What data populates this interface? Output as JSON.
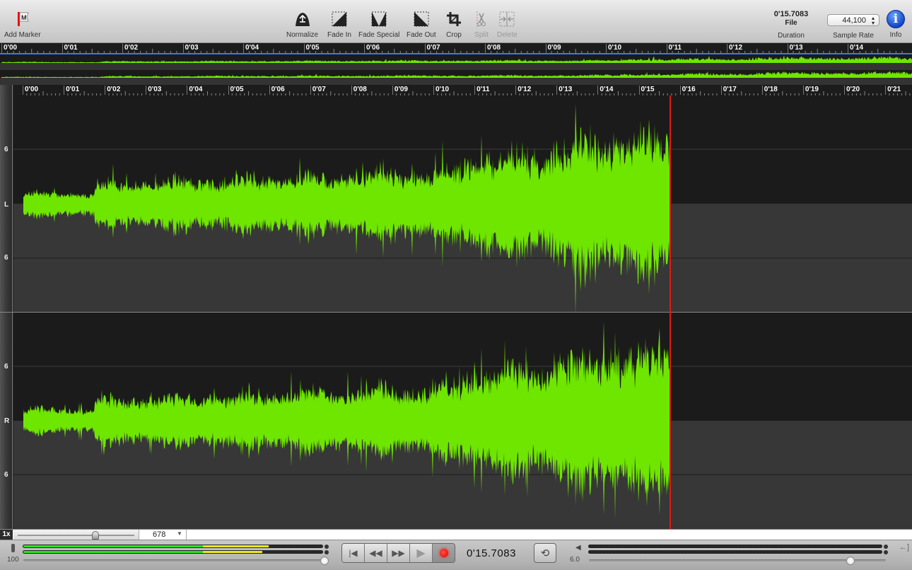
{
  "toolbar": {
    "add_marker": {
      "label": "Add Marker",
      "icon": "marker-flag-icon",
      "glyph": "M"
    },
    "tools": [
      {
        "label": "Normalize",
        "icon": "normalize-icon",
        "enabled": true
      },
      {
        "label": "Fade In",
        "icon": "fade-in-icon",
        "enabled": true
      },
      {
        "label": "Fade Special",
        "icon": "fade-special-icon",
        "enabled": true
      },
      {
        "label": "Fade Out",
        "icon": "fade-out-icon",
        "enabled": true
      },
      {
        "label": "Crop",
        "icon": "crop-icon",
        "enabled": true
      },
      {
        "label": "Split",
        "icon": "scissors-icon",
        "enabled": false
      },
      {
        "label": "Delete",
        "icon": "delete-icon",
        "enabled": false
      }
    ],
    "duration": {
      "time": "0'15.7083",
      "source": "File",
      "label": "Duration"
    },
    "sample_rate": {
      "value": "44,100",
      "label": "Sample Rate"
    },
    "info": {
      "label": "Info",
      "glyph": "i"
    }
  },
  "overview": {
    "ruler_labels": [
      "0'00",
      "0'01",
      "0'02",
      "0'03",
      "0'04",
      "0'05",
      "0'06",
      "0'07",
      "0'08",
      "0'09",
      "0'10",
      "0'11",
      "0'12",
      "0'13",
      "0'14"
    ]
  },
  "editor": {
    "ruler_labels": [
      "0'00",
      "0'01",
      "0'02",
      "0'03",
      "0'04",
      "0'05",
      "0'06",
      "0'07",
      "0'08",
      "0'09",
      "0'10",
      "0'11",
      "0'12",
      "0'13",
      "0'14",
      "0'15",
      "0'16",
      "0'17",
      "0'18",
      "0'19",
      "0'20",
      "0'21"
    ],
    "channels": [
      {
        "name": "L",
        "scale_top": "6",
        "scale_bottom": "6"
      },
      {
        "name": "R",
        "scale_top": "6",
        "scale_bottom": "6"
      }
    ],
    "playhead_time": "0'15.7083"
  },
  "zoom": {
    "factor_label": "1x",
    "value": "678",
    "dropdown_icon": "▼"
  },
  "transport": {
    "input_level_label": "100",
    "input_meter": {
      "left_green": 0.6,
      "left_yellow": 0.82,
      "right_green": 0.6,
      "right_yellow": 0.8
    },
    "input_volume": 1.0,
    "buttons": [
      {
        "name": "skip-to-start",
        "glyph": "⏮",
        "icon": "skip-start-icon"
      },
      {
        "name": "rewind",
        "glyph": "◀◀",
        "icon": "rewind-icon"
      },
      {
        "name": "fast-forward",
        "glyph": "▶▶",
        "icon": "fast-forward-icon"
      },
      {
        "name": "play",
        "glyph": "▶",
        "icon": "play-icon"
      },
      {
        "name": "record",
        "glyph": "",
        "icon": "record-icon"
      }
    ],
    "time_display": "0'15.7083",
    "loop_glyph": "⟲",
    "output_level_label": "6.0",
    "output_volume": 0.88,
    "colors": {
      "waveform": "#6ee600",
      "playhead": "#e01a10",
      "accent_blue": "#3a7be0"
    }
  }
}
